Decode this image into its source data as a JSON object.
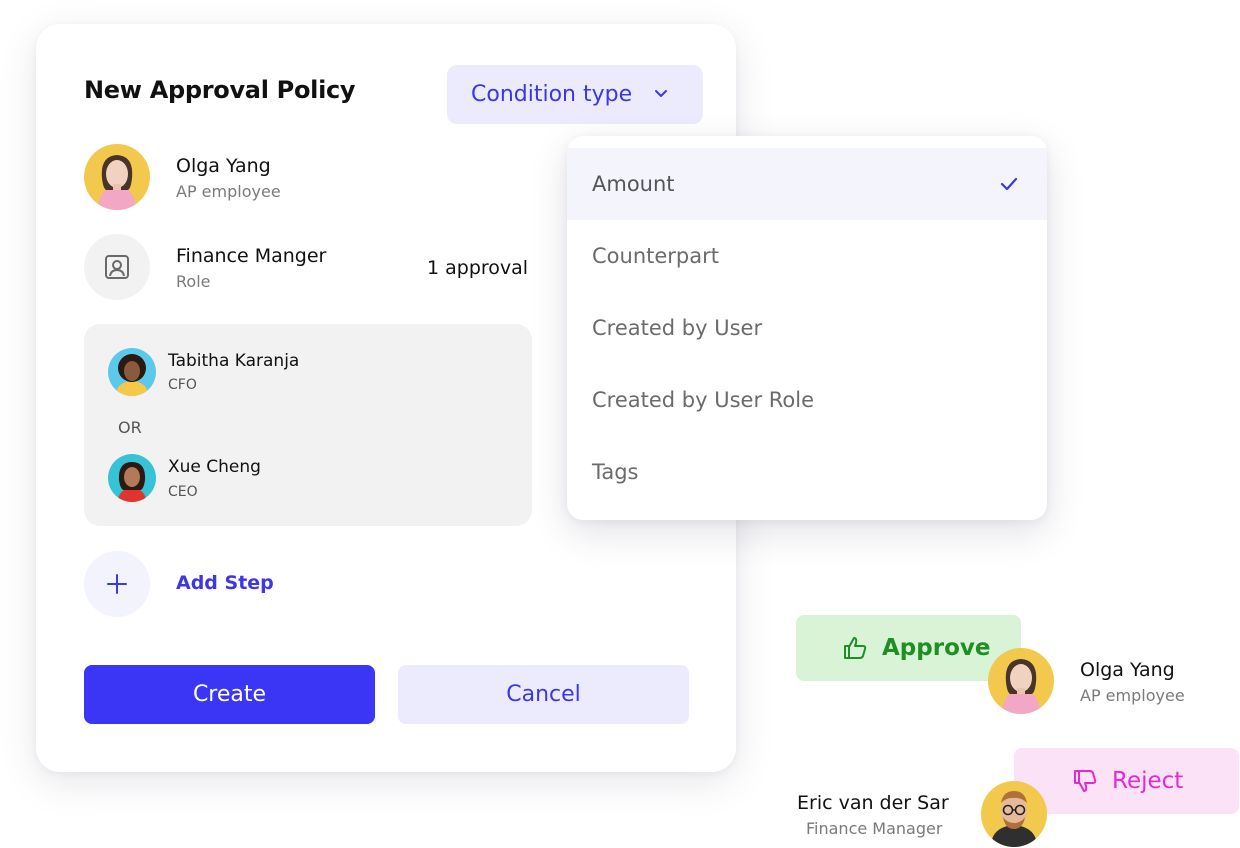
{
  "card": {
    "title": "New Approval Policy",
    "condition_button": "Condition type",
    "steps": [
      {
        "name": "Olga Yang",
        "subtitle": "AP employee"
      },
      {
        "name": "Finance Manger",
        "subtitle": "Role",
        "approvals": "1 approval"
      }
    ],
    "or_group": {
      "members": [
        {
          "name": "Tabitha Karanja",
          "subtitle": "CFO"
        },
        {
          "name": "Xue Cheng",
          "subtitle": "CEO"
        }
      ],
      "separator": "OR"
    },
    "add_step": "Add Step",
    "create_label": "Create",
    "cancel_label": "Cancel"
  },
  "dropdown": {
    "items": [
      "Amount",
      "Counterpart",
      "Created by User",
      "Created by User Role",
      "Tags"
    ],
    "selected": "Amount"
  },
  "actions": {
    "approve": {
      "label": "Approve",
      "user_name": "Olga Yang",
      "user_subtitle": "AP employee"
    },
    "reject": {
      "label": "Reject",
      "user_name": "Eric van der Sar",
      "user_subtitle": "Finance Manager"
    }
  },
  "colors": {
    "accent": "#3b36f5",
    "accent_light": "#ebebfd",
    "approve_bg": "#d9f3d7",
    "approve_text": "#1f8f23",
    "reject_bg": "#fbe2f6",
    "reject_text": "#e02ccf"
  }
}
